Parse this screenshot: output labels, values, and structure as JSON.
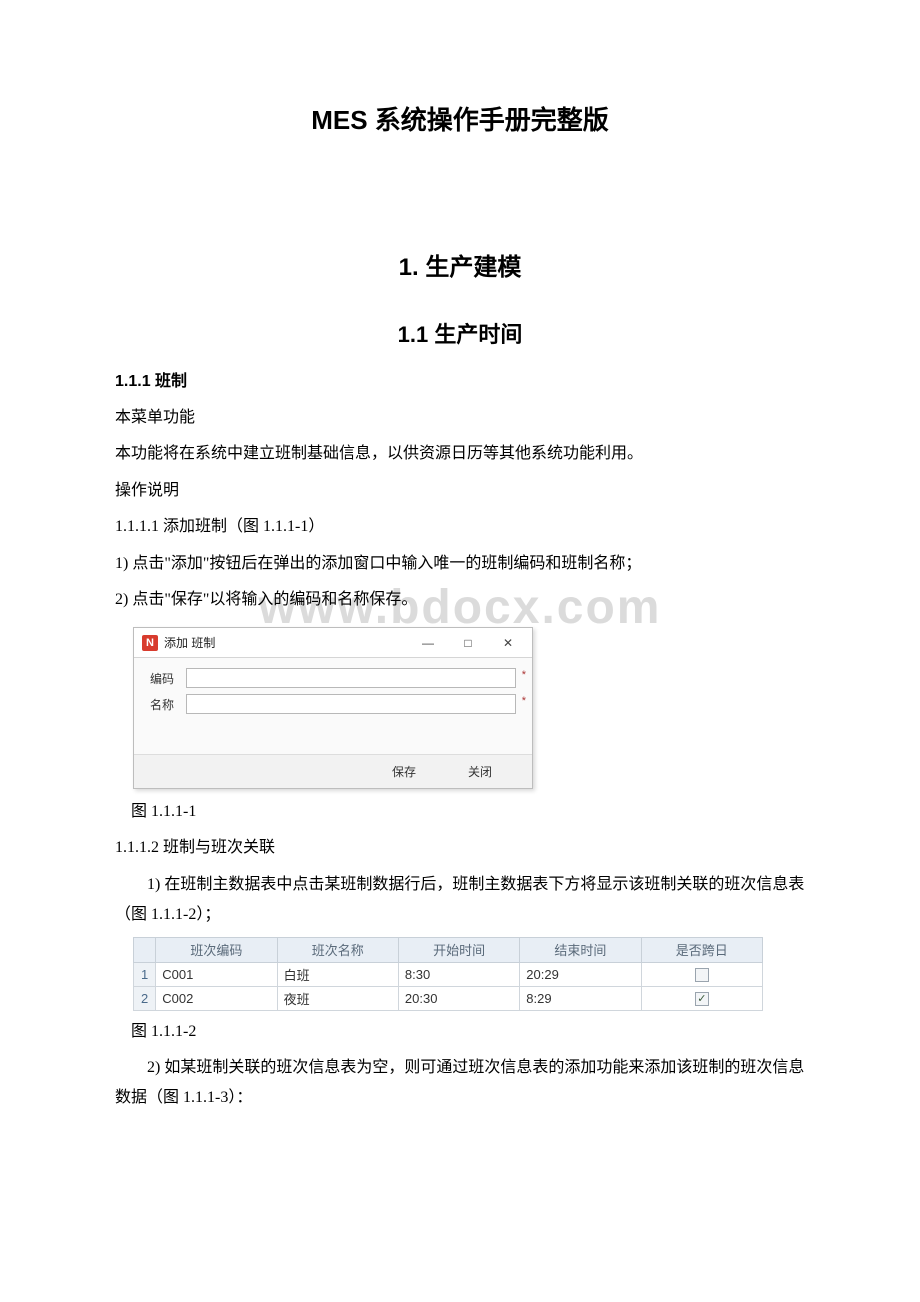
{
  "watermark": "www.bdocx.com",
  "title_main": "MES 系统操作手册完整版",
  "chapter": "1. 生产建模",
  "section": "1.1 生产时间",
  "subsection": "1.1.1 班制",
  "p_menu_label": "本菜单功能",
  "p_menu_desc": "本功能将在系统中建立班制基础信息，以供资源日历等其他系统功能利用。",
  "p_op_label": "操作说明",
  "p_1_1_1_1": "1.1.1.1 添加班制（图 1.1.1-1）",
  "p_step1": "1) 点击\"添加\"按钮后在弹出的添加窗口中输入唯一的班制编码和班制名称；",
  "p_step2": "2) 点击\"保存\"以将输入的编码和名称保存。",
  "dialog": {
    "title": "添加 班制",
    "icon_glyph": "N",
    "min_glyph": "—",
    "max_glyph": "□",
    "close_glyph": "✕",
    "label_code": "编码",
    "label_name": "名称",
    "asterisk": "*",
    "btn_save": "保存",
    "btn_close": "关闭"
  },
  "caption1": "图 1.1.1-1",
  "p_1_1_1_2": "1.1.1.2 班制与班次关联",
  "p_assoc_1": "1) 在班制主数据表中点击某班制数据行后，班制主数据表下方将显示该班制关联的班次信息表（图 1.1.1-2）；",
  "table": {
    "headers": [
      "班次编码",
      "班次名称",
      "开始时间",
      "结束时间",
      "是否跨日"
    ],
    "rows": [
      {
        "num": "1",
        "code": "C001",
        "name": "白班",
        "start": "8:30",
        "end": "20:29",
        "cross": false
      },
      {
        "num": "2",
        "code": "C002",
        "name": "夜班",
        "start": "20:30",
        "end": "8:29",
        "cross": true
      }
    ]
  },
  "caption2": "图 1.1.1-2",
  "p_assoc_2": "2) 如某班制关联的班次信息表为空，则可通过班次信息表的添加功能来添加该班制的班次信息数据（图 1.1.1-3）："
}
